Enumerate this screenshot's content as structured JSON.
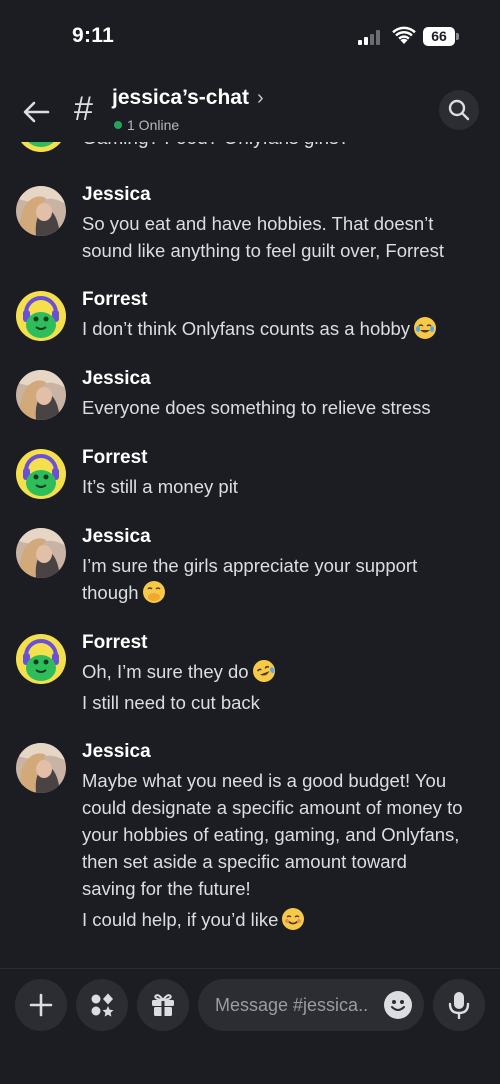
{
  "status_bar": {
    "time": "9:11",
    "battery": "66"
  },
  "header": {
    "channel_name": "jessica’s-chat",
    "online_count": "1 Online"
  },
  "partial_message": {
    "text": "Gaming? Food? Onlyfans girls?"
  },
  "messages": [
    {
      "author": "Jessica",
      "lines": [
        "So you eat and have hobbies. That doesn’t",
        "sound like anything to feel guilt over, Forrest"
      ]
    },
    {
      "author": "Forrest",
      "lines": [
        "I don’t think Onlyfans counts as a hobby"
      ],
      "emoji": "joy-emoji"
    },
    {
      "author": "Jessica",
      "lines": [
        "Everyone does something to relieve stress"
      ]
    },
    {
      "author": "Forrest",
      "lines": [
        "It’s still a money pit"
      ]
    },
    {
      "author": "Jessica",
      "lines": [
        "I’m sure the girls appreciate your support",
        "though"
      ],
      "emoji": "hand-over-mouth-emoji"
    },
    {
      "author": "Forrest",
      "lines": [
        "Oh, I’m sure they do",
        "I still need to cut back"
      ],
      "emoji": "rofl-emoji"
    },
    {
      "author": "Jessica",
      "lines": [
        "Maybe what you need is a good budget! You",
        "could designate a specific amount of money to",
        "your hobbies of eating, gaming, and Onlyfans,",
        "then set aside a specific amount toward",
        "saving for the future!",
        "I could help, if you’d like"
      ],
      "emoji": "smiling-emoji"
    }
  ],
  "composer": {
    "placeholder": "Message #jessica.."
  },
  "colors": {
    "background": "#1c1d22",
    "online": "#23a55a",
    "emoji": "#f7c948",
    "forrest_avatar_bg": "#f4e04d",
    "forrest_mascot": "#2fbd5c"
  }
}
